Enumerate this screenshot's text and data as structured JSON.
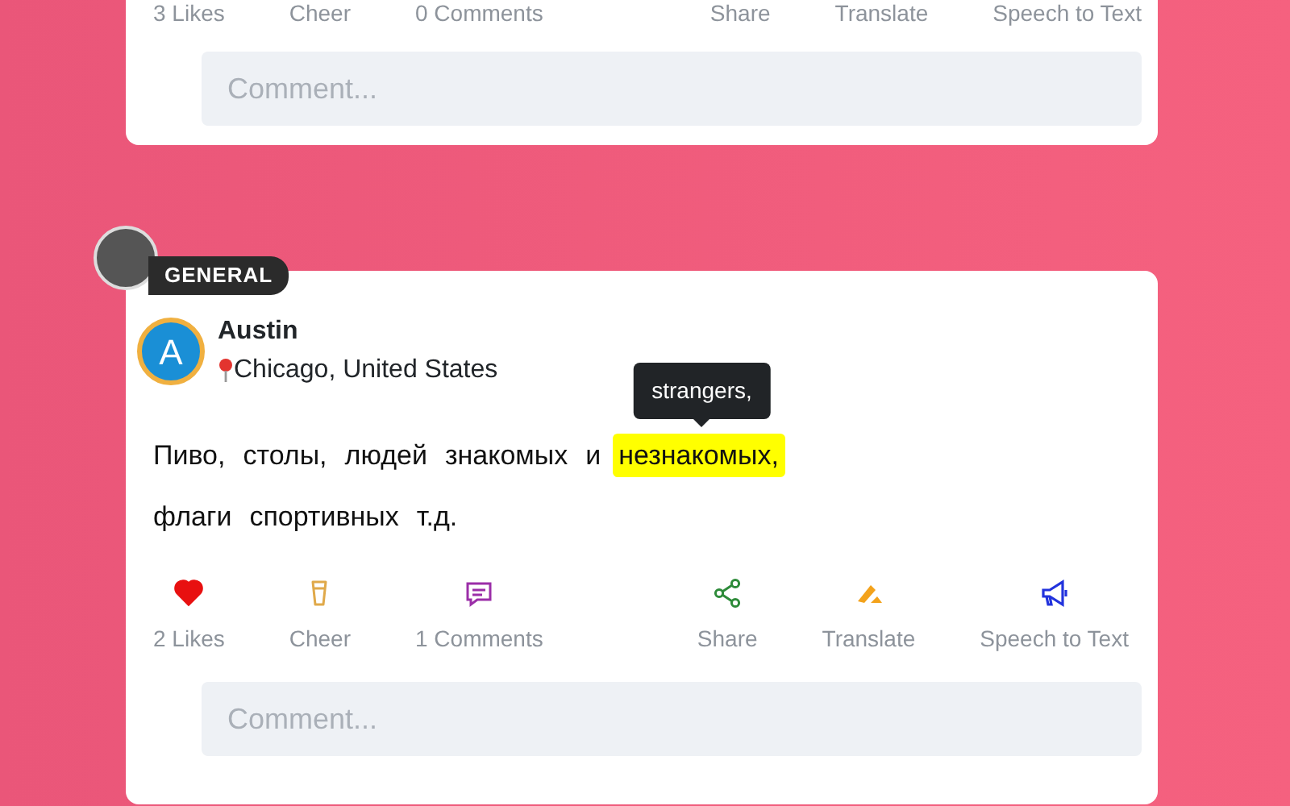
{
  "posts": [
    {
      "actions": [
        "3 Likes",
        "Cheer",
        "0 Comments",
        "Share",
        "Translate",
        "Speech to Text"
      ],
      "comment": {
        "placeholder": "Comment..."
      }
    },
    {
      "category": "GENERAL",
      "author": {
        "initial": "A",
        "name": "Austin",
        "location": "Chicago, United States"
      },
      "lines": [
        [
          {
            "text": "Пиво,"
          },
          {
            "text": "столы,"
          },
          {
            "text": "людей"
          },
          {
            "text": "знакомых"
          },
          {
            "text": "и"
          },
          {
            "text": "незнакомых,",
            "highlighted": true,
            "tooltip": "strangers,"
          }
        ],
        [
          {
            "text": "флаги"
          },
          {
            "text": "спортивных"
          },
          {
            "text": "т.д."
          }
        ]
      ],
      "actions": [
        {
          "kind": "like",
          "label": "2 Likes",
          "on": true
        },
        {
          "kind": "cheer",
          "label": "Cheer"
        },
        {
          "kind": "comment",
          "label": "1 Comments"
        },
        {
          "kind": "share",
          "label": "Share"
        },
        {
          "kind": "translate",
          "label": "Translate"
        },
        {
          "kind": "speech",
          "label": "Speech to Text"
        }
      ],
      "comment": {
        "placeholder": "Comment..."
      }
    }
  ]
}
